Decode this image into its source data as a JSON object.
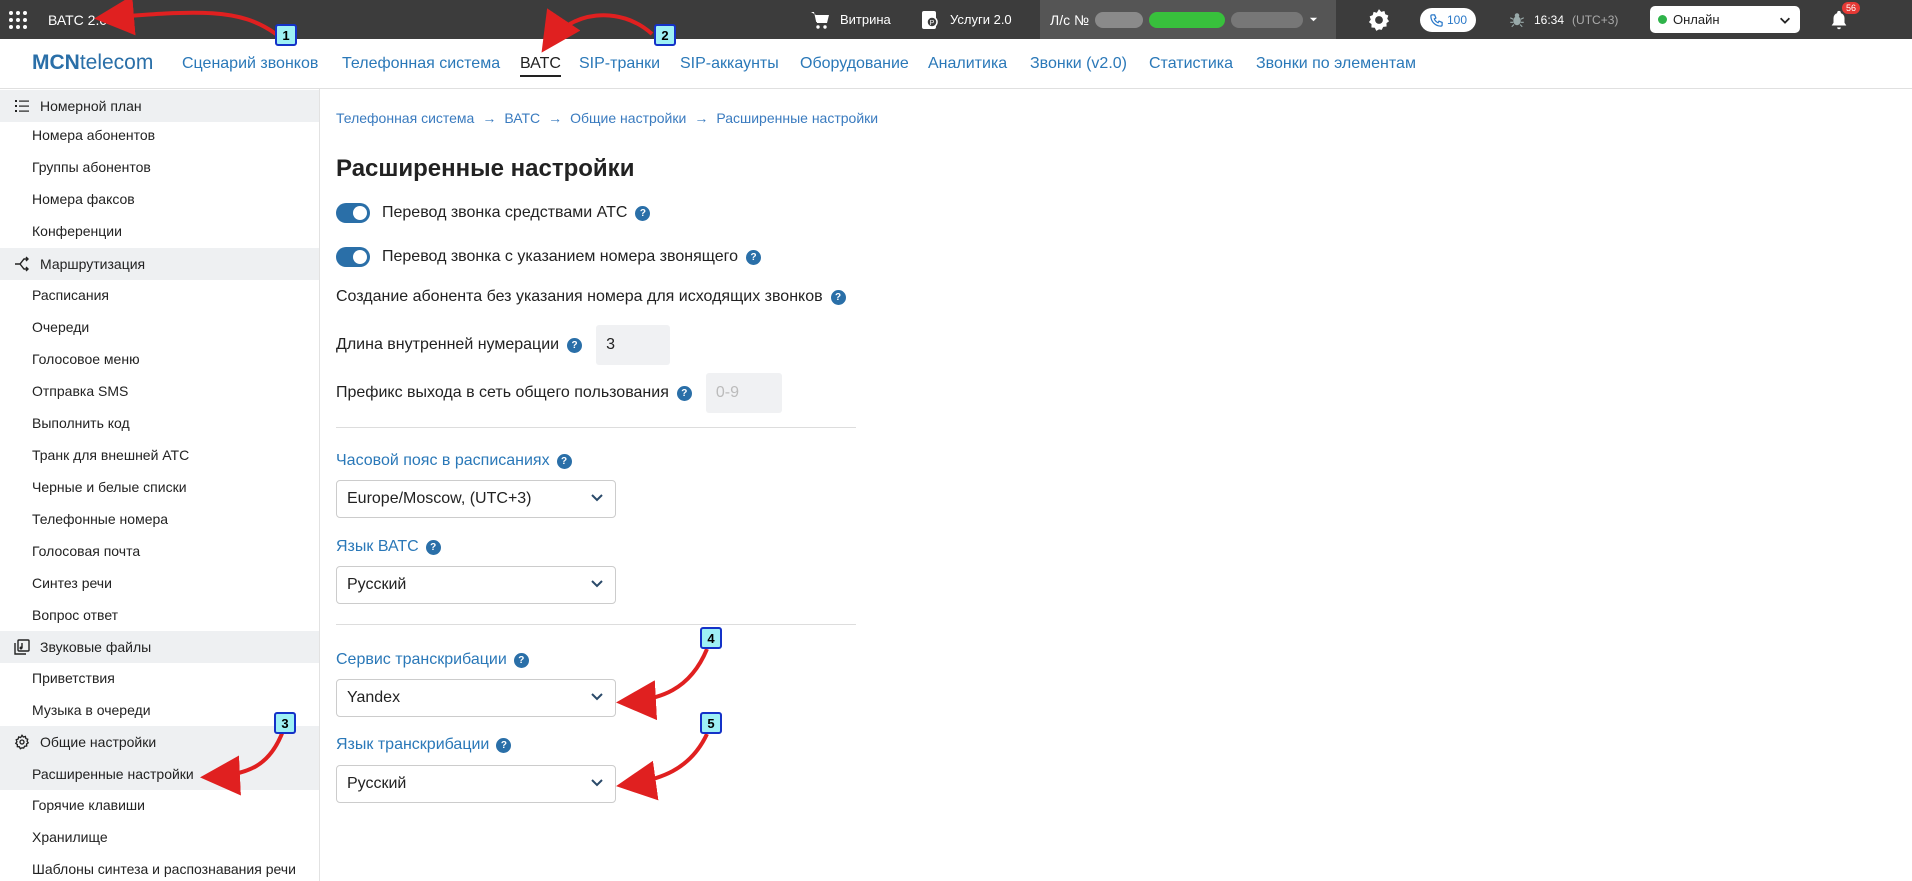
{
  "topbar": {
    "app_title": "ВАТС 2.0",
    "showcase": "Витрина",
    "services": "Услуги 2.0",
    "account_prefix": "Л/с №",
    "phone_count": "100",
    "time": "16:34",
    "timezone": "(UTC+3)",
    "status": "Онлайн",
    "notifications": "56"
  },
  "nav": {
    "logo_bold": "MCN",
    "logo_rest": "telecom",
    "items": [
      "Сценарий звонков",
      "Телефонная система",
      "ВАТС",
      "SIP-транки",
      "SIP-аккаунты",
      "Оборудование",
      "Аналитика",
      "Звонки (v2.0)",
      "Статистика",
      "Звонки по элементам"
    ]
  },
  "sidebar": {
    "groups": [
      "Номерной план",
      "Маршрутизация",
      "Звуковые файлы",
      "Общие настройки"
    ],
    "numbering": [
      "Номера абонентов",
      "Группы абонентов",
      "Номера факсов",
      "Конференции"
    ],
    "routing": [
      "Расписания",
      "Очереди",
      "Голосовое меню",
      "Отправка SMS",
      "Выполнить код",
      "Транк для внешней АТС",
      "Черные и белые списки",
      "Телефонные номера",
      "Голосовая почта",
      "Синтез речи",
      "Вопрос ответ"
    ],
    "sounds": [
      "Приветствия",
      "Музыка в очереди"
    ],
    "general": [
      "Расширенные настройки",
      "Горячие клавиши",
      "Хранилище",
      "Шаблоны синтеза и распознавания речи"
    ]
  },
  "main": {
    "breadcrumbs": [
      "Телефонная система",
      "ВАТС",
      "Общие настройки",
      "Расширенные настройки"
    ],
    "title": "Расширенные настройки",
    "toggle1": "Перевод звонка средствами АТС",
    "toggle2": "Перевод звонка с указанием номера звонящего",
    "create_subscriber": "Создание абонента без указания номера для исходящих звонков",
    "ext_length_label": "Длина внутренней нумерации",
    "ext_length_value": "3",
    "prefix_label": "Префикс выхода в сеть общего пользования",
    "prefix_placeholder": "0-9",
    "tz_label": "Часовой пояс в расписаниях",
    "tz_value": "Europe/Moscow, (UTC+3)",
    "lang_label": "Язык ВАТС",
    "lang_value": "Русский",
    "trans_service_label": "Сервис транскрибации",
    "trans_service_value": "Yandex",
    "trans_lang_label": "Язык транскрибации",
    "trans_lang_value": "Русский",
    "help_glyph": "?"
  },
  "annotations": [
    "1",
    "2",
    "3",
    "4",
    "5"
  ],
  "colors": {
    "topbar": "#3c3c3c",
    "link": "#2a78b8",
    "toggle": "#2a6fa8",
    "arrow": "#e02020",
    "callout_bg": "#9ef0f5",
    "status_dot": "#2fb34a"
  }
}
